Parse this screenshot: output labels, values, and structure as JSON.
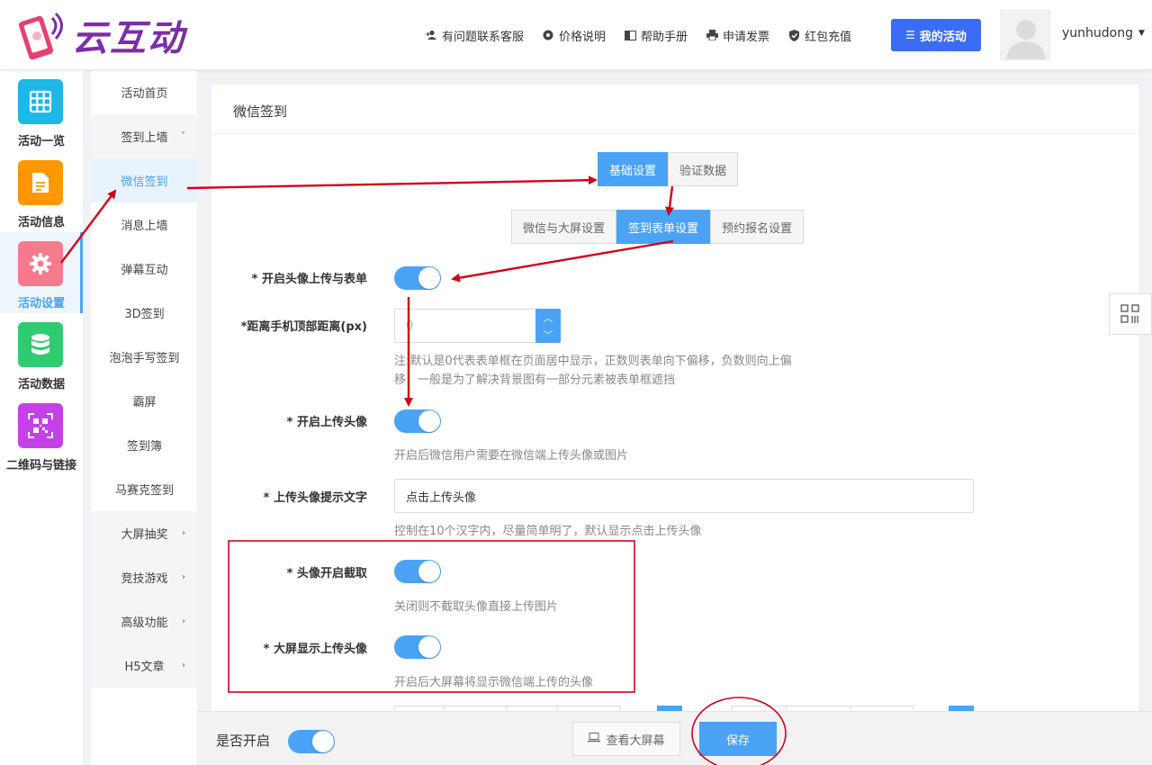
{
  "brand": {
    "name": "云互动"
  },
  "top_nav": {
    "items": [
      {
        "icon": "add-user-icon",
        "label": "有问题联系客服"
      },
      {
        "icon": "gear-icon",
        "label": "价格说明"
      },
      {
        "icon": "book-icon",
        "label": "帮助手册"
      },
      {
        "icon": "printer-icon",
        "label": "申请发票"
      },
      {
        "icon": "shield-check-icon",
        "label": "红包充值"
      }
    ],
    "my_activity": "我的活动",
    "username": "yunhudong"
  },
  "icon_sidebar": {
    "items": [
      {
        "label": "活动一览",
        "icon": "grid-icon",
        "color": "#1bb8e8"
      },
      {
        "label": "活动信息",
        "icon": "document-icon",
        "color": "#ff9800"
      },
      {
        "label": "活动设置",
        "icon": "gear-icon",
        "color": "#f77a8c",
        "active": true
      },
      {
        "label": "活动数据",
        "icon": "database-icon",
        "color": "#2ecc71"
      },
      {
        "label": "二维码与链接",
        "icon": "qrcode-icon",
        "color": "#c441e8"
      }
    ]
  },
  "sub_menu": {
    "items": [
      {
        "label": "活动首页"
      },
      {
        "label": "签到上墙",
        "arrow": "˅"
      },
      {
        "label": "微信签到",
        "active": true
      },
      {
        "label": "消息上墙"
      },
      {
        "label": "弹幕互动"
      },
      {
        "label": "3D签到"
      },
      {
        "label": "泡泡手写签到"
      },
      {
        "label": "霸屏"
      },
      {
        "label": "签到簿"
      },
      {
        "label": "马赛克签到"
      },
      {
        "label": "大屏抽奖",
        "arrow": "›"
      },
      {
        "label": "竞技游戏",
        "arrow": "›"
      },
      {
        "label": "高级功能",
        "arrow": "›"
      },
      {
        "label": "H5文章",
        "arrow": "›"
      }
    ]
  },
  "main": {
    "title": "微信签到",
    "tabs_top": [
      "基础设置",
      "验证数据"
    ],
    "tabs_sub": [
      "微信与大屏设置",
      "签到表单设置",
      "预约报名设置"
    ],
    "fields": {
      "avatar_form": {
        "label": "* 开启头像上传与表单",
        "on": true
      },
      "top_distance": {
        "label": "*距离手机顶部距离(px)",
        "value": "0",
        "hint_line1": "注:默认是0代表表单框在页面居中显示，正数则表单向下偏移，负数则向上偏",
        "hint_line2": "移，一般是为了解决背景图有一部分元素被表单框遮挡"
      },
      "upload_avatar": {
        "label": "* 开启上传头像",
        "on": true,
        "hint": "开启后微信用户需要在微信端上传头像或图片"
      },
      "upload_prompt": {
        "label": "* 上传头像提示文字",
        "value": "点击上传头像",
        "hint": "控制在10个汉字内，尽量简单明了，默认显示点击上传头像"
      },
      "avatar_crop": {
        "label": "* 头像开启截取",
        "on": true,
        "hint": "关闭则不截取头像直接上传图片"
      },
      "bigscreen_avatar": {
        "label": "* 大屏显示上传头像",
        "on": true,
        "hint": "开启后大屏幕将显示微信端上传的头像"
      }
    }
  },
  "footer": {
    "enabled_label": "是否开启",
    "enabled": true,
    "view_label": "查看大屏幕",
    "save_label": "保存"
  },
  "colors": {
    "accent": "#4aa3f5",
    "primary_button": "#3b6cf6",
    "annotation": "#d0021b"
  }
}
